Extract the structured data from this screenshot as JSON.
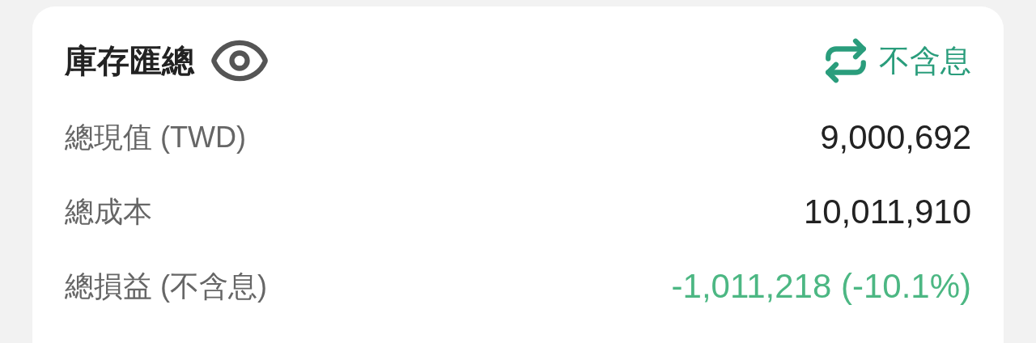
{
  "card": {
    "title": "庫存匯總",
    "toggle": {
      "label": "不含息"
    },
    "rows": [
      {
        "label": "總現值 (TWD)",
        "value": "9,000,692",
        "color": "#222222"
      },
      {
        "label": "總成本",
        "value": "10,011,910",
        "color": "#222222"
      },
      {
        "label": "總損益 (不含息)",
        "value": "-1,011,218 (-10.1%)",
        "color": "#4cb783"
      }
    ]
  }
}
